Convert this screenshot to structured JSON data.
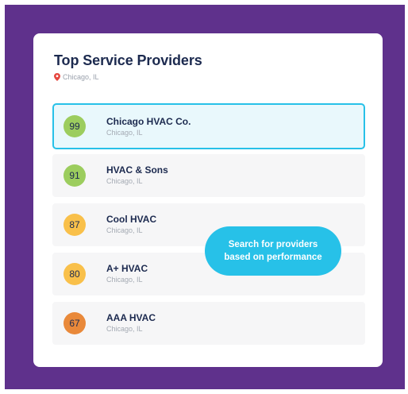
{
  "panel": {
    "title": "Top Service Providers",
    "location": "Chicago, IL"
  },
  "providers": [
    {
      "score": "99",
      "name": "Chicago HVAC Co.",
      "location": "Chicago, IL",
      "badge_color": "#9ccd5e",
      "selected": true
    },
    {
      "score": "91",
      "name": "HVAC & Sons",
      "location": "Chicago, IL",
      "badge_color": "#9ccd5e",
      "selected": false
    },
    {
      "score": "87",
      "name": "Cool HVAC",
      "location": "Chicago, IL",
      "badge_color": "#f9c04a",
      "selected": false
    },
    {
      "score": "80",
      "name": "A+ HVAC",
      "location": "Chicago, IL",
      "badge_color": "#f9c04a",
      "selected": false
    },
    {
      "score": "67",
      "name": "AAA HVAC",
      "location": "Chicago, IL",
      "badge_color": "#e9893a",
      "selected": false
    }
  ],
  "callout": {
    "line1": "Search for providers",
    "line2": "based on performance"
  },
  "colors": {
    "background": "#5f318c",
    "accent": "#27c1e8",
    "title": "#1c2a4f",
    "pin": "#e5473f"
  }
}
